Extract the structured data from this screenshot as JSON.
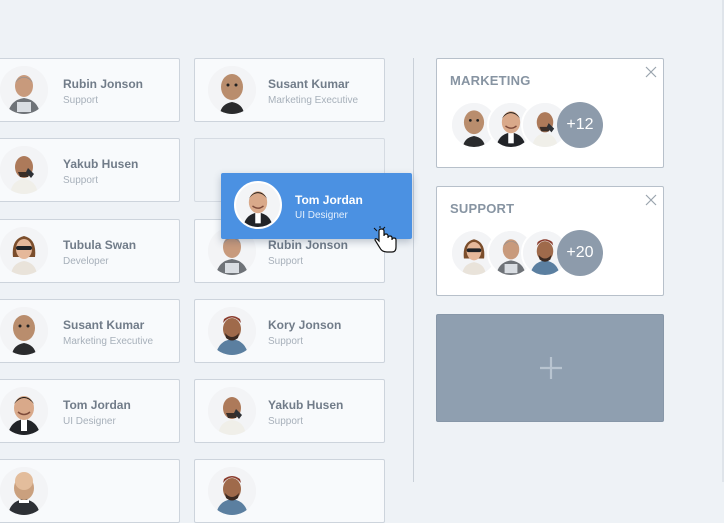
{
  "people": {
    "col1": [
      {
        "name": "Rubin Jonson",
        "role": "Support",
        "avatar": "elder-man-avatar"
      },
      {
        "name": "Yakub Husen",
        "role": "Support",
        "avatar": "phone-man-avatar"
      },
      {
        "name": "Tubula Swan",
        "role": "Developer",
        "avatar": "sunglasses-woman-avatar"
      },
      {
        "name": "Susant Kumar",
        "role": "Marketing Executive",
        "avatar": "bald-man-avatar"
      },
      {
        "name": "Tom Jordan",
        "role": "UI  Designer",
        "avatar": "smiling-man-avatar"
      }
    ],
    "col2": [
      {
        "name": "Susant Kumar",
        "role": "Marketing Executive",
        "avatar": "bald-man-avatar"
      },
      {
        "name": "Rubin Jonson",
        "role": "Support",
        "avatar": "elder-man-avatar"
      },
      {
        "name": "Kory Jonson",
        "role": "Support",
        "avatar": "bearded-man-avatar"
      },
      {
        "name": "Yakub Husen",
        "role": "Support",
        "avatar": "phone-man-avatar"
      }
    ]
  },
  "dragged": {
    "name": "Tom Jordan",
    "role": "UI  Designer",
    "avatar": "smiling-man-avatar"
  },
  "groups": [
    {
      "title": "MARKETING",
      "more": "+12"
    },
    {
      "title": "SUPPORT",
      "more": "+20"
    }
  ],
  "colors": {
    "accent": "#4b91e2",
    "add_tile": "#8f9fb0",
    "more_badge": "#8d9bab"
  },
  "icons": {
    "close": "close-icon",
    "add": "plus-icon",
    "cursor": "hand-pointer-icon"
  }
}
